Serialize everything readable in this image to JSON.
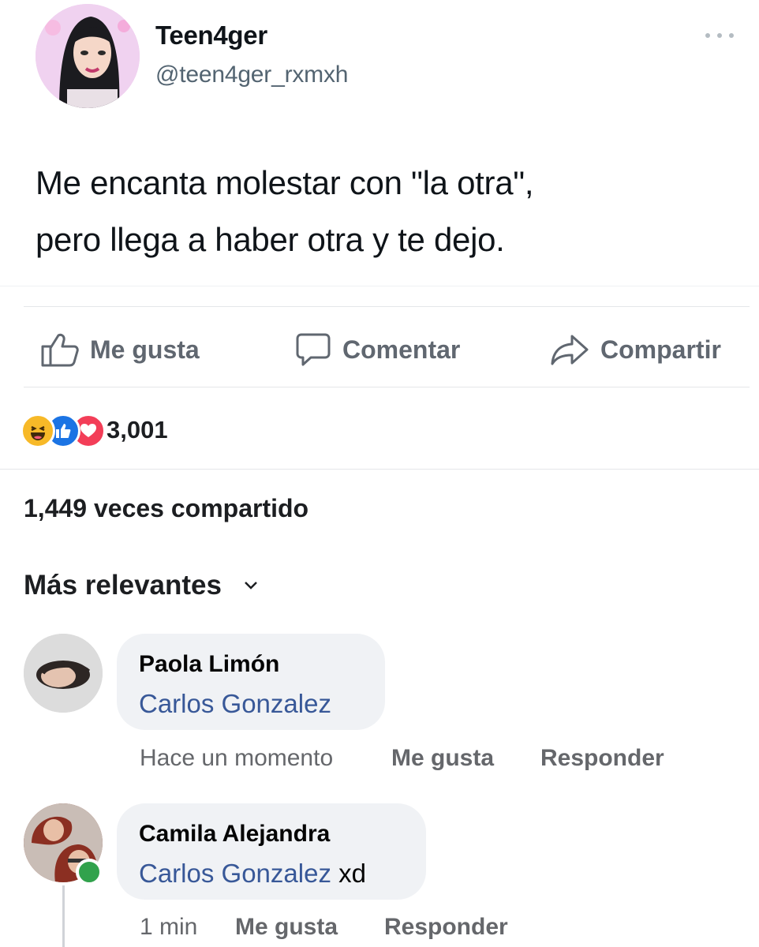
{
  "tweet": {
    "name": "Teen4ger",
    "handle": "@teen4ger_rxmxh",
    "text_line1": "Me encanta molestar con \"la otra\",",
    "text_line2": "pero llega a haber otra y te dejo.",
    "more_icon": "ellipsis-icon"
  },
  "actions": {
    "like_label": "Me gusta",
    "comment_label": "Comentar",
    "share_label": "Compartir"
  },
  "stats": {
    "reaction_icons": [
      "haha-reaction-icon",
      "like-reaction-icon",
      "love-reaction-icon"
    ],
    "reaction_count": "3,001",
    "shares_text": "1,449 veces compartido"
  },
  "comments_sort": {
    "label": "Más relevantes"
  },
  "comments": [
    {
      "author": "Paola Limón",
      "mention": "Carlos Gonzalez",
      "text": "",
      "time": "Hace un momento",
      "like_label": "Me gusta",
      "reply_label": "Responder"
    },
    {
      "author": "Camila Alejandra",
      "mention": "Carlos Gonzalez",
      "text": " xd",
      "time": "1 min",
      "like_label": "Me gusta",
      "reply_label": "Responder"
    }
  ],
  "colors": {
    "action_gray": "#606770",
    "mention_blue": "#385898",
    "online_green": "#31a24c",
    "bubble_bg": "#f0f2f5"
  }
}
